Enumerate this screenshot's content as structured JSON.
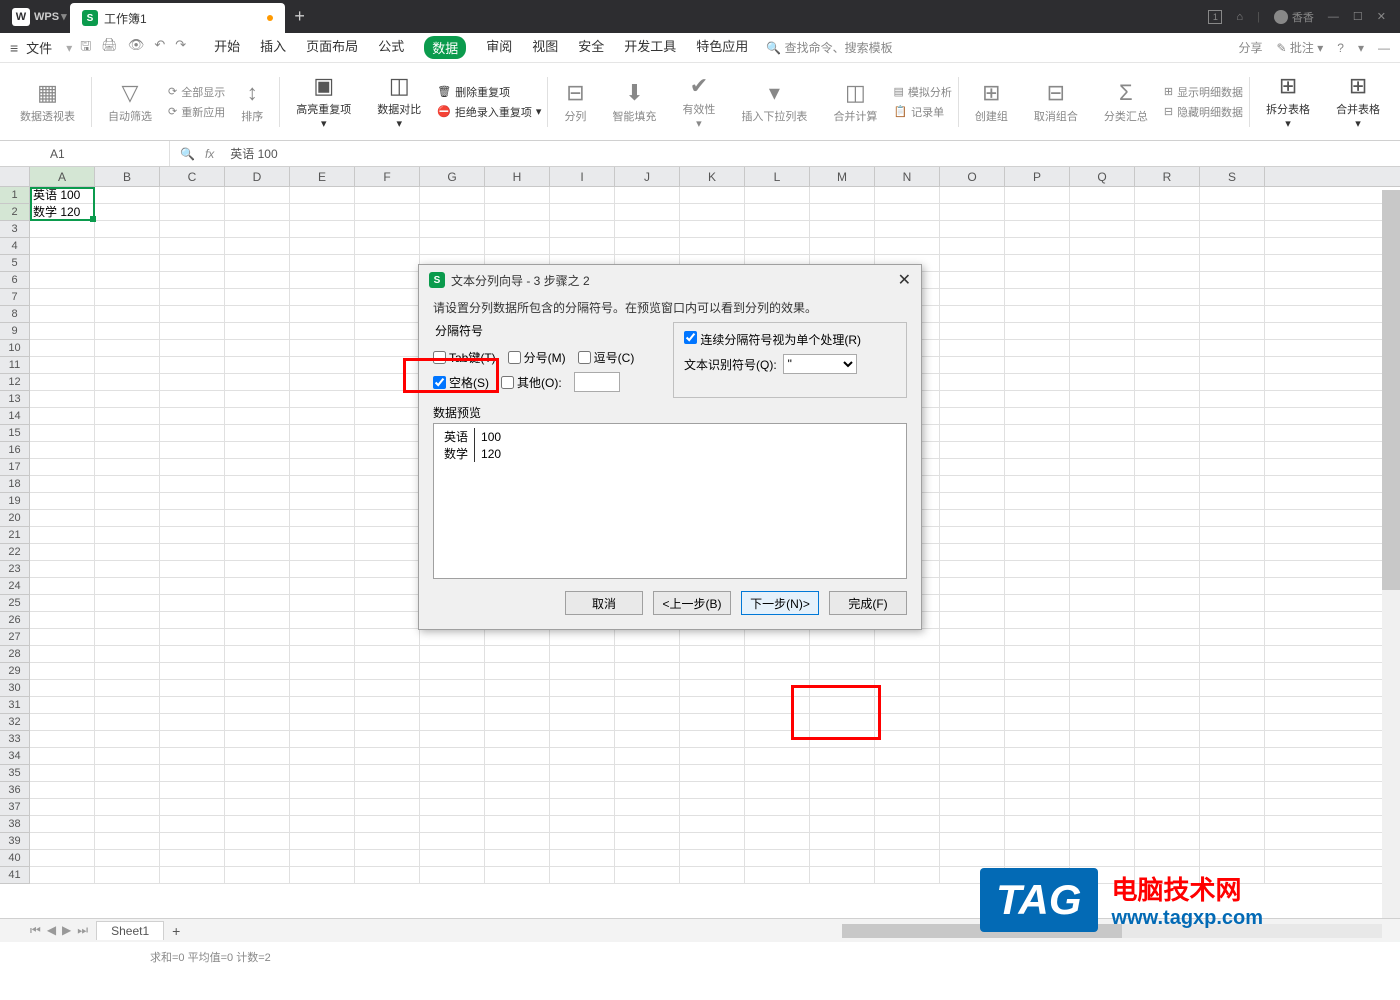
{
  "titlebar": {
    "brand": "WPS",
    "tab_label": "工作簿1",
    "tab_s": "S",
    "add": "+",
    "num_box": "1",
    "user": "香香"
  },
  "menubar": {
    "file": "文件",
    "tabs": [
      "开始",
      "插入",
      "页面布局",
      "公式",
      "数据",
      "审阅",
      "视图",
      "安全",
      "开发工具",
      "特色应用"
    ],
    "active_index": 4,
    "search": "查找命令、搜索模板",
    "share": "分享",
    "annotate": "批注"
  },
  "ribbon": {
    "pivot": "数据透视表",
    "autofilter": "自动筛选",
    "show_all": "全部显示",
    "reapply": "重新应用",
    "sort": "排序",
    "highlight_dup": "高亮重复项",
    "data_compare": "数据对比",
    "remove_dup": "删除重复项",
    "reject_dup": "拒绝录入重复项",
    "text_to_cols": "分列",
    "smart_fill": "智能填充",
    "validation": "有效性",
    "dropdown": "插入下拉列表",
    "consolidate": "合并计算",
    "whatif": "模拟分析",
    "record": "记录单",
    "group": "创建组",
    "ungroup": "取消组合",
    "subtotal": "分类汇总",
    "show_detail": "显示明细数据",
    "hide_detail": "隐藏明细数据",
    "split_table": "拆分表格",
    "merge_table": "合并表格"
  },
  "fbar": {
    "name": "A1",
    "formula": "英语 100"
  },
  "columns": [
    "A",
    "B",
    "C",
    "D",
    "E",
    "F",
    "G",
    "H",
    "I",
    "J",
    "K",
    "L",
    "M",
    "N",
    "O",
    "P",
    "Q",
    "R",
    "S"
  ],
  "data_rows": [
    [
      "英语 100"
    ],
    [
      "数学 120"
    ]
  ],
  "dialog": {
    "title": "文本分列向导 - 3 步骤之 2",
    "desc": "请设置分列数据所包含的分隔符号。在预览窗口内可以看到分列的效果。",
    "delim_legend": "分隔符号",
    "tab": "Tab键(T)",
    "semicolon": "分号(M)",
    "comma": "逗号(C)",
    "space": "空格(S)",
    "other": "其他(O):",
    "treat_consec": "连续分隔符号视为单个处理(R)",
    "text_qual": "文本识别符号(Q):",
    "qual_value": "\"",
    "preview_label": "数据预览",
    "preview": [
      [
        "英语",
        "100"
      ],
      [
        "数学",
        "120"
      ]
    ],
    "btn_cancel": "取消",
    "btn_back": "<上一步(B)",
    "btn_next": "下一步(N)>",
    "btn_finish": "完成(F)",
    "checked": {
      "tab": false,
      "semicolon": false,
      "comma": false,
      "space": true,
      "other": false,
      "consec": true
    }
  },
  "sheets": {
    "active": "Sheet1"
  },
  "statusbar": "求和=0   平均值=0   计数=2",
  "watermark": {
    "tag": "TAG",
    "line1": "电脑技术网",
    "line2": "www.tagxp.com"
  }
}
